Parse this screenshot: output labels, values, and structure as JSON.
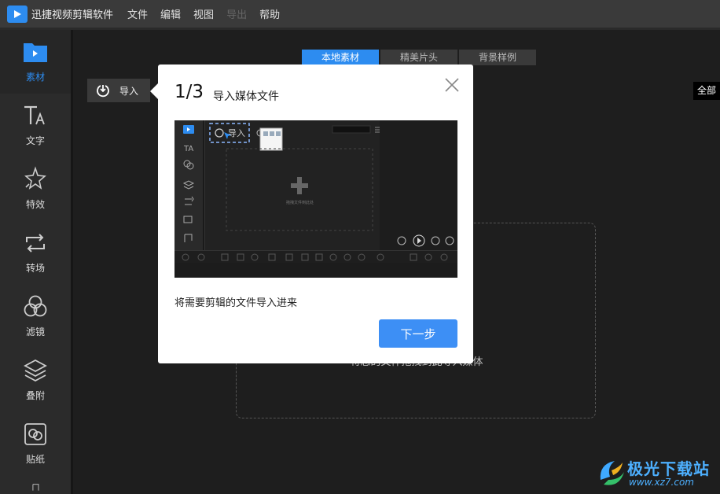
{
  "app": {
    "title": "迅捷视频剪辑软件"
  },
  "menu": [
    "文件",
    "编辑",
    "视图",
    "导出",
    "帮助"
  ],
  "sidebar": {
    "items": [
      {
        "label": "素材",
        "icon": "folder-icon",
        "active": true
      },
      {
        "label": "文字",
        "icon": "text-icon"
      },
      {
        "label": "特效",
        "icon": "sparkle-icon"
      },
      {
        "label": "转场",
        "icon": "transition-icon"
      },
      {
        "label": "滤镜",
        "icon": "filter-icon"
      },
      {
        "label": "叠附",
        "icon": "layers-icon"
      },
      {
        "label": "贴纸",
        "icon": "sticker-icon"
      }
    ]
  },
  "tabs": [
    {
      "label": "本地素材",
      "active": true
    },
    {
      "label": "精美片头"
    },
    {
      "label": "背景样例"
    }
  ],
  "filter": {
    "label": "全部"
  },
  "import_button": {
    "label": "导入"
  },
  "drop_zone": {
    "text": "将您的文件拖拽到此导入媒体"
  },
  "guide": {
    "step": "1/3",
    "title": "导入媒体文件",
    "description": "将需要剪辑的文件导入进来",
    "next_label": "下一步",
    "preview": {
      "import_label": "导入",
      "video_label": "视频"
    }
  },
  "watermark": {
    "name": "极光下载站",
    "url": "www.xz7.com"
  },
  "colors": {
    "accent": "#2d8cf0",
    "button": "#3d8ff5",
    "bg": "#1e1e1e",
    "sidebar": "#2b2b2b"
  }
}
